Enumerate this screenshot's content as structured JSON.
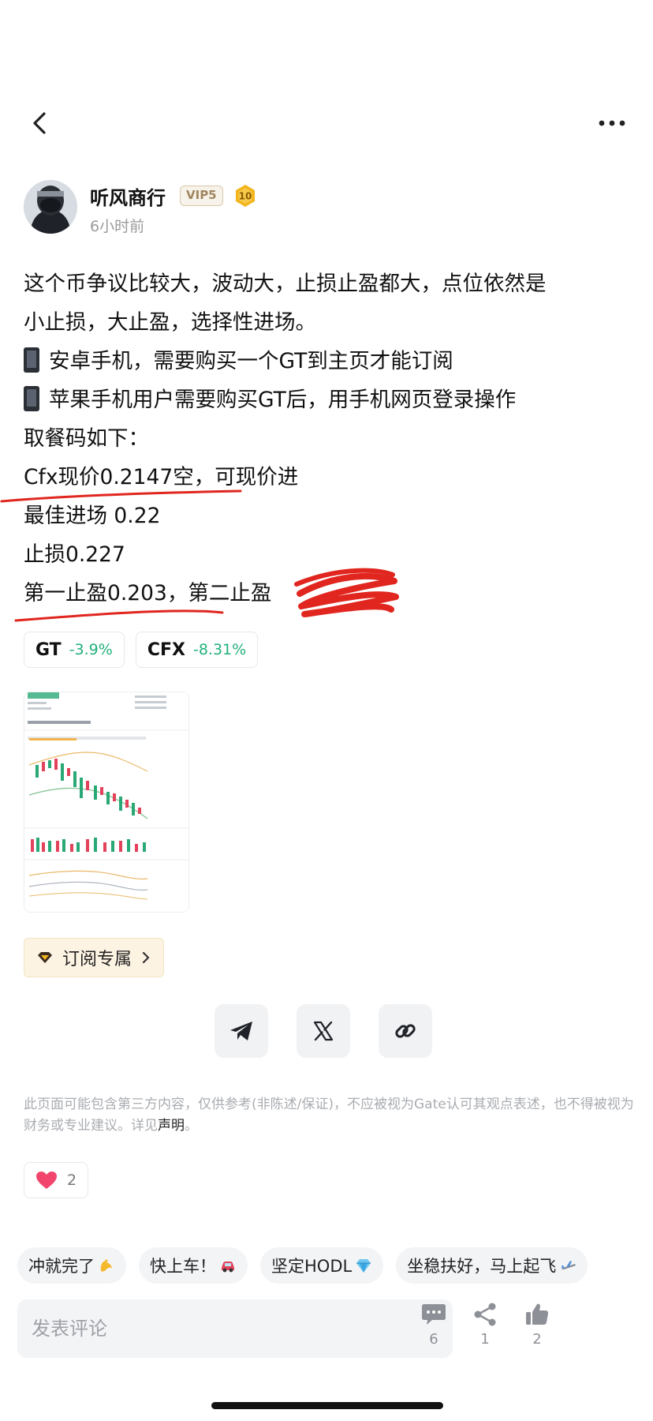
{
  "author": {
    "name": "听风商行",
    "vip": "VIP5",
    "level": "10",
    "time": "6小时前"
  },
  "post": {
    "lines": [
      "这个币争议比较大，波动大，止损止盈都大，点位依然是",
      "小止损，大止盈，选择性进场。",
      "安卓手机，需要购买一个GT到主页才能订阅",
      "苹果手机用户需要购买GT后，用手机网页登录操作",
      "取餐码如下：",
      "Cfx现价0.2147空，可现价进",
      "最佳进场 0.22",
      "止损0.227",
      "第一止盈0.203，第二止盈"
    ]
  },
  "coins": [
    {
      "symbol": "GT",
      "change": "-3.9%"
    },
    {
      "symbol": "CFX",
      "change": "-8.31%"
    }
  ],
  "subscribe_label": "订阅专属",
  "disclaimer": {
    "text": "此页面可能包含第三方内容，仅供参考(非陈述/保证)，不应被视为Gate认可其观点表述，也不得被视为财务或专业建议。详见",
    "link": "声明",
    "end": "。"
  },
  "likes": "2",
  "quick_replies": [
    "冲就完了",
    "快上车！",
    "坚定HODL",
    "坐稳扶好，马上起飞"
  ],
  "comment_placeholder": "发表评论",
  "actions": {
    "comments": "6",
    "shares": "1",
    "likes": "2"
  },
  "colors": {
    "accent_green": "#23b07b",
    "scribble_red": "#e0261e",
    "like_pink": "#f2456e"
  }
}
